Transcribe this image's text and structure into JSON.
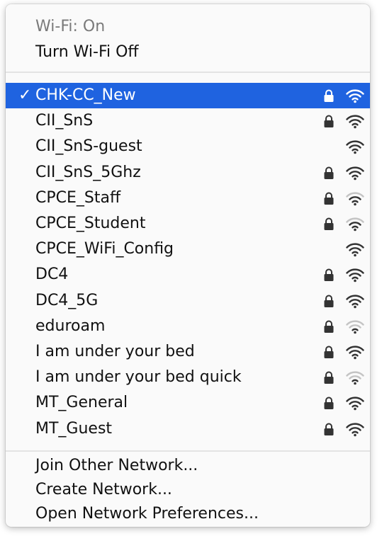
{
  "status": {
    "wifi_status": "Wi-Fi: On",
    "toggle_label": "Turn Wi-Fi Off"
  },
  "networks": [
    {
      "name": "CHK-CC_New",
      "selected": true,
      "secured": true,
      "signal": 3
    },
    {
      "name": "CII_SnS",
      "selected": false,
      "secured": true,
      "signal": 3
    },
    {
      "name": "CII_SnS-guest",
      "selected": false,
      "secured": false,
      "signal": 3
    },
    {
      "name": "CII_SnS_5Ghz",
      "selected": false,
      "secured": true,
      "signal": 3
    },
    {
      "name": "CPCE_Staff",
      "selected": false,
      "secured": true,
      "signal": 2
    },
    {
      "name": "CPCE_Student",
      "selected": false,
      "secured": true,
      "signal": 2
    },
    {
      "name": "CPCE_WiFi_Config",
      "selected": false,
      "secured": false,
      "signal": 3
    },
    {
      "name": "DC4",
      "selected": false,
      "secured": true,
      "signal": 3
    },
    {
      "name": "DC4_5G",
      "selected": false,
      "secured": true,
      "signal": 3
    },
    {
      "name": "eduroam",
      "selected": false,
      "secured": true,
      "signal": 1
    },
    {
      "name": "I am under your bed",
      "selected": false,
      "secured": true,
      "signal": 3
    },
    {
      "name": "I am under your bed quick",
      "selected": false,
      "secured": true,
      "signal": 1
    },
    {
      "name": "MT_General",
      "selected": false,
      "secured": true,
      "signal": 3
    },
    {
      "name": "MT_Guest",
      "selected": false,
      "secured": true,
      "signal": 3
    }
  ],
  "checkmark": "✓",
  "actions": {
    "join_other": "Join Other Network...",
    "create": "Create Network...",
    "preferences": "Open Network Preferences..."
  },
  "colors": {
    "selection": "#1f63e0",
    "signal_active": "#333333",
    "signal_inactive": "#c4c4c4"
  },
  "icons": {
    "lock": "lock-icon",
    "wifi": "wifi-signal-icon",
    "check": "checkmark-icon"
  }
}
